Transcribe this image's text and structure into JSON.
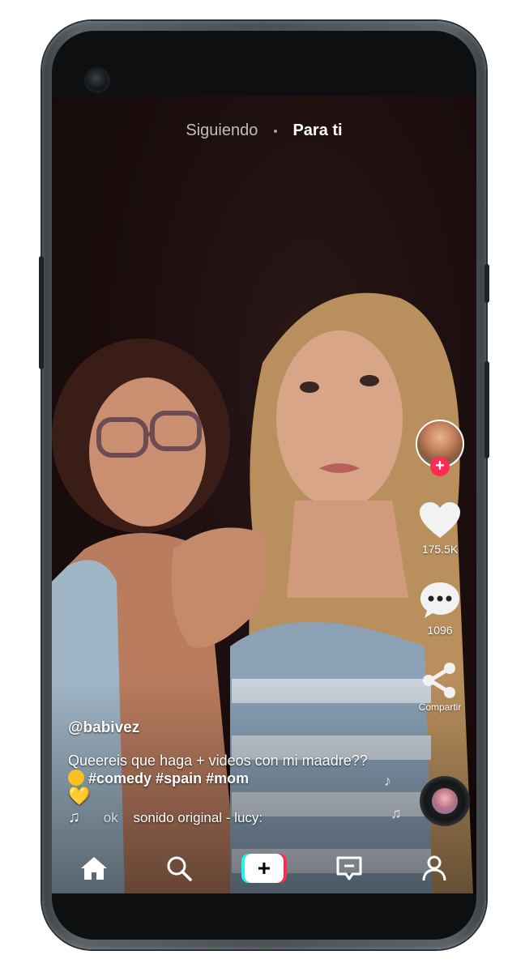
{
  "feed_tabs": {
    "following": "Siguiendo",
    "for_you": "Para ti"
  },
  "right_rail": {
    "likes": "175.5K",
    "comments": "1096",
    "share_label": "Compartir"
  },
  "post": {
    "username": "@babivez",
    "description_text": "Queereis que haga + videos con mi maadre??",
    "hashtags": "#comedy #spain #mom",
    "emoji_heart": "💛",
    "sound_prefix": "ok",
    "sound": "sonido original - lucy:"
  },
  "bottom_nav": {
    "items": [
      "home-icon",
      "search-icon",
      "create-icon",
      "inbox-icon",
      "profile-icon"
    ],
    "create_symbol": "+"
  },
  "colors": {
    "accent_red": "#fe2c55",
    "accent_cyan": "#25f4ee",
    "background": "#1c0e0f"
  }
}
